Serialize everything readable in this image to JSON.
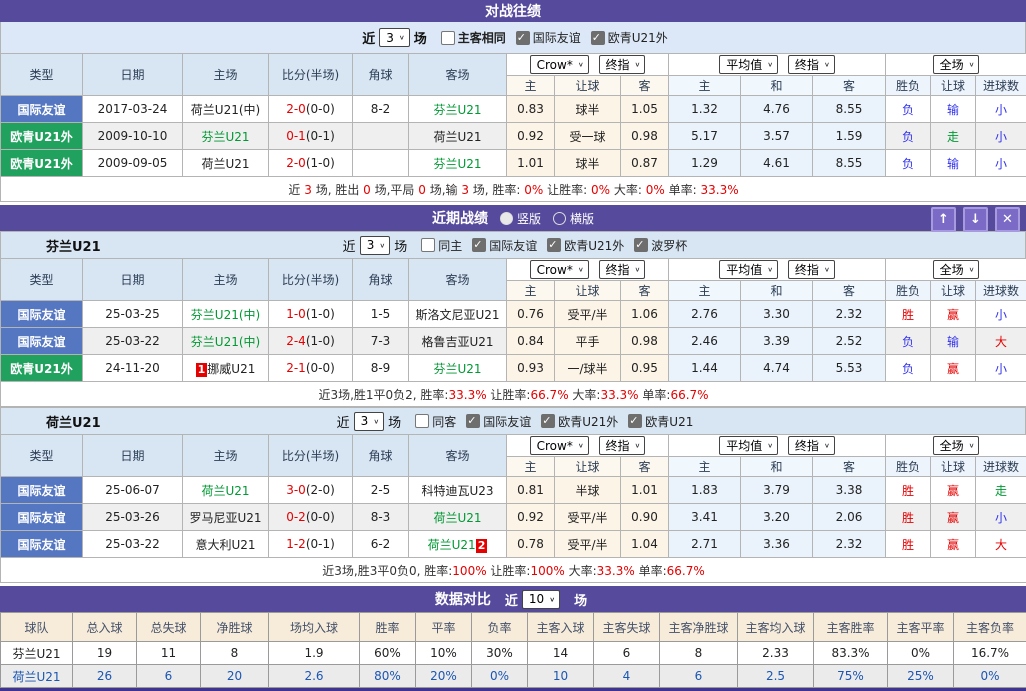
{
  "icons": {
    "up": "↑",
    "down": "↓",
    "close": "✕",
    "chevron": "∨"
  },
  "colors": {
    "bar_purple": "#564a9c",
    "badge_blue": "#5577c2",
    "badge_green": "#21a15e",
    "team_green": "#009933",
    "score_red": "#e60000",
    "result_blue": "#3333ee",
    "link_blue": "#1a56b4",
    "header_beige": "#f7ecd9"
  },
  "shared": {
    "cols": {
      "type": "类型",
      "date": "日期",
      "home": "主场",
      "score": "比分(半场)",
      "corner": "角球",
      "away": "客场",
      "h": "主",
      "hcp": "让球",
      "a": "客",
      "eh": "主",
      "ed": "和",
      "ea": "客",
      "wdl": "胜负",
      "hcp2": "让球",
      "goals": "进球数"
    },
    "selects": {
      "company": "Crow*",
      "stage": "终指",
      "avg": "平均值",
      "stage2": "终指",
      "scope": "全场"
    }
  },
  "h2h": {
    "title": "对战往绩",
    "filter": {
      "near": "近",
      "count": "3",
      "unit": "场",
      "checks": [
        {
          "label": "主客相同",
          "cls": ""
        },
        {
          "label": "国际友谊",
          "cls": "on"
        },
        {
          "label": "欧青U21外",
          "cls": "on"
        }
      ]
    },
    "rows": [
      {
        "type": {
          "text": "国际友谊",
          "cls": "badge-blue"
        },
        "date": "2017-03-24",
        "home": {
          "text": "荷兰U21(中)"
        },
        "score": "2-0",
        "half": "(0-0)",
        "corner": "8-2",
        "away": {
          "text": "芬兰U21",
          "cls": "c-green"
        },
        "o1": "0.83",
        "ohcp": "球半",
        "o2": "1.05",
        "e1": "1.32",
        "e2": "4.76",
        "e3": "8.55",
        "r1": {
          "t": "负",
          "c": "c-blue"
        },
        "r2": {
          "t": "输",
          "c": "c-blue"
        },
        "r3": {
          "t": "小",
          "c": "c-blue"
        }
      },
      {
        "type": {
          "text": "欧青U21外",
          "cls": "badge-green"
        },
        "date": "2009-10-10",
        "home": {
          "text": "芬兰U21",
          "cls": "c-green"
        },
        "score": "0-1",
        "half": "(0-1)",
        "corner": "",
        "away": {
          "text": "荷兰U21"
        },
        "o1": "0.92",
        "ohcp": "受一球",
        "o2": "0.98",
        "e1": "5.17",
        "e2": "3.57",
        "e3": "1.59",
        "r1": {
          "t": "负",
          "c": "c-blue"
        },
        "r2": {
          "t": "走",
          "c": "c-green"
        },
        "r3": {
          "t": "小",
          "c": "c-blue"
        }
      },
      {
        "type": {
          "text": "欧青U21外",
          "cls": "badge-green"
        },
        "date": "2009-09-05",
        "home": {
          "text": "荷兰U21"
        },
        "score": "2-0",
        "half": "(1-0)",
        "corner": "",
        "away": {
          "text": "芬兰U21",
          "cls": "c-green"
        },
        "o1": "1.01",
        "ohcp": "球半",
        "o2": "0.87",
        "e1": "1.29",
        "e2": "4.61",
        "e3": "8.55",
        "r1": {
          "t": "负",
          "c": "c-blue"
        },
        "r2": {
          "t": "输",
          "c": "c-blue"
        },
        "r3": {
          "t": "小",
          "c": "c-blue"
        }
      }
    ],
    "summary": [
      {
        "t": "近 "
      },
      {
        "t": "3",
        "c": "red"
      },
      {
        "t": " 场, 胜出 "
      },
      {
        "t": "0",
        "c": "red"
      },
      {
        "t": " 场,平局 "
      },
      {
        "t": "0",
        "c": "red"
      },
      {
        "t": " 场,输 "
      },
      {
        "t": "3",
        "c": "red"
      },
      {
        "t": " 场, 胜率: "
      },
      {
        "t": "0%",
        "c": "red"
      },
      {
        "t": " 让胜率: "
      },
      {
        "t": "0%",
        "c": "red"
      },
      {
        "t": " 大率: "
      },
      {
        "t": "0%",
        "c": "red"
      },
      {
        "t": " 单率: "
      },
      {
        "t": "33.3%",
        "c": "red"
      }
    ]
  },
  "recent": {
    "title": "近期战绩",
    "radio_vertical": {
      "label": "竖版",
      "cls": "on"
    },
    "radio_horizontal": {
      "label": "横版",
      "cls": ""
    },
    "teams": [
      {
        "name": "芬兰U21",
        "filter": {
          "near": "近",
          "count": "3",
          "unit": "场",
          "checks": [
            {
              "label": "同主",
              "cls": ""
            },
            {
              "label": "国际友谊",
              "cls": "on"
            },
            {
              "label": "欧青U21外",
              "cls": "on"
            },
            {
              "label": "波罗杯",
              "cls": "on"
            }
          ]
        },
        "rows": [
          {
            "type": {
              "text": "国际友谊",
              "cls": "badge-blue"
            },
            "date": "25-03-25",
            "home": {
              "text": "芬兰U21(中)",
              "cls": "c-green"
            },
            "score": "1-0",
            "half": "(1-0)",
            "corner": "1-5",
            "away": {
              "text": "斯洛文尼亚U21"
            },
            "o1": "0.76",
            "ohcp": "受平/半",
            "o2": "1.06",
            "e1": "2.76",
            "e2": "3.30",
            "e3": "2.32",
            "r1": {
              "t": "胜",
              "c": "c-red"
            },
            "r2": {
              "t": "赢",
              "c": "c-red"
            },
            "r3": {
              "t": "小",
              "c": "c-blue"
            }
          },
          {
            "type": {
              "text": "国际友谊",
              "cls": "badge-blue"
            },
            "date": "25-03-22",
            "home": {
              "text": "芬兰U21(中)",
              "cls": "c-green"
            },
            "score": "2-4",
            "half": "(1-0)",
            "corner": "7-3",
            "away": {
              "text": "格鲁吉亚U21"
            },
            "o1": "0.84",
            "ohcp": "平手",
            "o2": "0.98",
            "e1": "2.46",
            "e2": "3.39",
            "e3": "2.52",
            "r1": {
              "t": "负",
              "c": "c-blue"
            },
            "r2": {
              "t": "输",
              "c": "c-blue"
            },
            "r3": {
              "t": "大",
              "c": "c-red"
            }
          },
          {
            "type": {
              "text": "欧青U21外",
              "cls": "badge-green"
            },
            "date": "24-11-20",
            "home": {
              "b1": "1",
              "text": "挪威U21"
            },
            "score": "2-1",
            "half": "(0-0)",
            "corner": "8-9",
            "away": {
              "text": "芬兰U21",
              "cls": "c-green"
            },
            "o1": "0.93",
            "ohcp": "一/球半",
            "o2": "0.95",
            "e1": "1.44",
            "e2": "4.74",
            "e3": "5.53",
            "r1": {
              "t": "负",
              "c": "c-blue"
            },
            "r2": {
              "t": "赢",
              "c": "c-red"
            },
            "r3": {
              "t": "小",
              "c": "c-blue"
            }
          }
        ],
        "summary": [
          {
            "t": "近3场,胜1平0负2, 胜率:"
          },
          {
            "t": "33.3%",
            "c": "red"
          },
          {
            "t": " 让胜率:"
          },
          {
            "t": "66.7%",
            "c": "red"
          },
          {
            "t": " 大率:"
          },
          {
            "t": "33.3%",
            "c": "red"
          },
          {
            "t": " 单率:"
          },
          {
            "t": "66.7%",
            "c": "red"
          }
        ]
      },
      {
        "name": "荷兰U21",
        "filter": {
          "near": "近",
          "count": "3",
          "unit": "场",
          "checks": [
            {
              "label": "同客",
              "cls": ""
            },
            {
              "label": "国际友谊",
              "cls": "on"
            },
            {
              "label": "欧青U21外",
              "cls": "on"
            },
            {
              "label": "欧青U21",
              "cls": "on"
            }
          ]
        },
        "rows": [
          {
            "type": {
              "text": "国际友谊",
              "cls": "badge-blue"
            },
            "date": "25-06-07",
            "home": {
              "text": "荷兰U21",
              "cls": "c-green"
            },
            "score": "3-0",
            "half": "(2-0)",
            "corner": "2-5",
            "away": {
              "text": "科特迪瓦U23"
            },
            "o1": "0.81",
            "ohcp": "半球",
            "o2": "1.01",
            "e1": "1.83",
            "e2": "3.79",
            "e3": "3.38",
            "r1": {
              "t": "胜",
              "c": "c-red"
            },
            "r2": {
              "t": "赢",
              "c": "c-red"
            },
            "r3": {
              "t": "走",
              "c": "c-green"
            }
          },
          {
            "type": {
              "text": "国际友谊",
              "cls": "badge-blue"
            },
            "date": "25-03-26",
            "home": {
              "text": "罗马尼亚U21"
            },
            "score": "0-2",
            "half": "(0-0)",
            "corner": "8-3",
            "away": {
              "text": "荷兰U21",
              "cls": "c-green"
            },
            "o1": "0.92",
            "ohcp": "受平/半",
            "o2": "0.90",
            "e1": "3.41",
            "e2": "3.20",
            "e3": "2.06",
            "r1": {
              "t": "胜",
              "c": "c-red"
            },
            "r2": {
              "t": "赢",
              "c": "c-red"
            },
            "r3": {
              "t": "小",
              "c": "c-blue"
            }
          },
          {
            "type": {
              "text": "国际友谊",
              "cls": "badge-blue"
            },
            "date": "25-03-22",
            "home": {
              "text": "意大利U21"
            },
            "score": "1-2",
            "half": "(0-1)",
            "corner": "6-2",
            "away": {
              "text": "荷兰U21",
              "cls": "c-green",
              "b2": "2"
            },
            "o1": "0.78",
            "ohcp": "受平/半",
            "o2": "1.04",
            "e1": "2.71",
            "e2": "3.36",
            "e3": "2.32",
            "r1": {
              "t": "胜",
              "c": "c-red"
            },
            "r2": {
              "t": "赢",
              "c": "c-red"
            },
            "r3": {
              "t": "大",
              "c": "c-red"
            }
          }
        ],
        "summary": [
          {
            "t": "近3场,胜3平0负0, 胜率:"
          },
          {
            "t": "100%",
            "c": "red"
          },
          {
            "t": " 让胜率:"
          },
          {
            "t": "100%",
            "c": "red"
          },
          {
            "t": " 大率:"
          },
          {
            "t": "33.3%",
            "c": "red"
          },
          {
            "t": " 单率:"
          },
          {
            "t": "66.7%",
            "c": "red"
          }
        ]
      }
    ]
  },
  "compare": {
    "title": "数据对比",
    "filter": {
      "near": "近",
      "count": "10",
      "unit": "场"
    },
    "headers": [
      "球队",
      "总入球",
      "总失球",
      "净胜球",
      "场均入球",
      "胜率",
      "平率",
      "负率",
      "主客入球",
      "主客失球",
      "主客净胜球",
      "主客均入球",
      "主客胜率",
      "主客平率",
      "主客负率"
    ],
    "rows": [
      {
        "cls": "row-plain",
        "cells": [
          "芬兰U21",
          "19",
          "11",
          "8",
          "1.9",
          "60%",
          "10%",
          "30%",
          "14",
          "6",
          "8",
          "2.33",
          "83.3%",
          "0%",
          "16.7%"
        ]
      },
      {
        "cls": "row-blue",
        "cells": [
          "荷兰U21",
          "26",
          "6",
          "20",
          "2.6",
          "80%",
          "20%",
          "0%",
          "10",
          "4",
          "6",
          "2.5",
          "75%",
          "25%",
          "0%"
        ]
      }
    ]
  }
}
